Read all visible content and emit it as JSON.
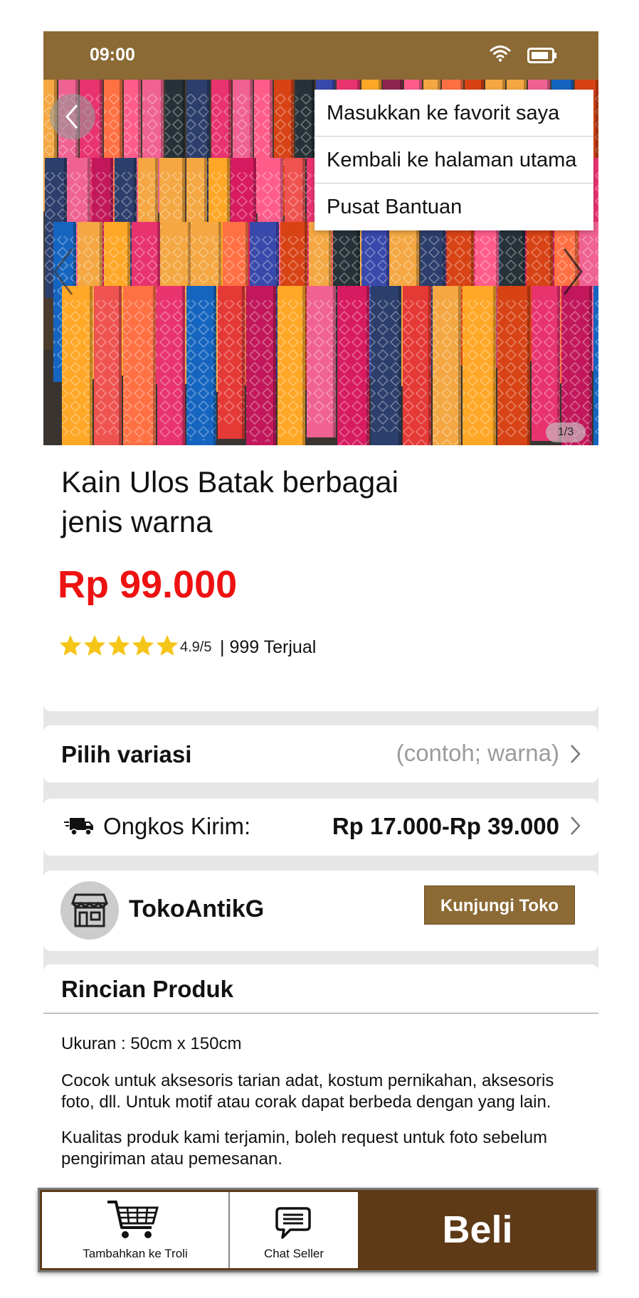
{
  "status_bar": {
    "time": "09:00"
  },
  "hero": {
    "image_counter": "1/3"
  },
  "menu": {
    "items": [
      {
        "label": "Masukkan ke favorit saya"
      },
      {
        "label": "Kembali ke halaman utama"
      },
      {
        "label": "Pusat Bantuan"
      }
    ]
  },
  "product": {
    "title": "Kain Ulos Batak berbagai jenis warna",
    "price": "Rp 99.000",
    "rating_value": 4.9,
    "rating": "4.9/5",
    "sold": "| 999 Terjual"
  },
  "variation": {
    "label": "Pilih variasi",
    "hint": "(contoh; warna)"
  },
  "shipping": {
    "label": "Ongkos Kirim:",
    "value": "Rp 17.000-Rp 39.000"
  },
  "store": {
    "name": "TokoAntikG",
    "visit_label": "Kunjungi Toko"
  },
  "details": {
    "title": "Rincian Produk",
    "size": "Ukuran : 50cm x 150cm",
    "paragraph1": "Cocok untuk aksesoris tarian adat, kostum pernikahan, aksesoris foto, dll. Untuk motif atau corak dapat berbeda dengan yang lain.",
    "paragraph2": "Kualitas produk kami terjamin, boleh request untuk foto sebelum pengiriman atau pemesanan."
  },
  "bottom_bar": {
    "cart_label": "Tambahkan ke Troli",
    "chat_label": "Chat Seller",
    "buy_label": "Beli"
  },
  "colors": {
    "brand": "#8b6a35",
    "buy": "#5e3a17",
    "price": "#ee1111",
    "star": "#f5c518"
  }
}
